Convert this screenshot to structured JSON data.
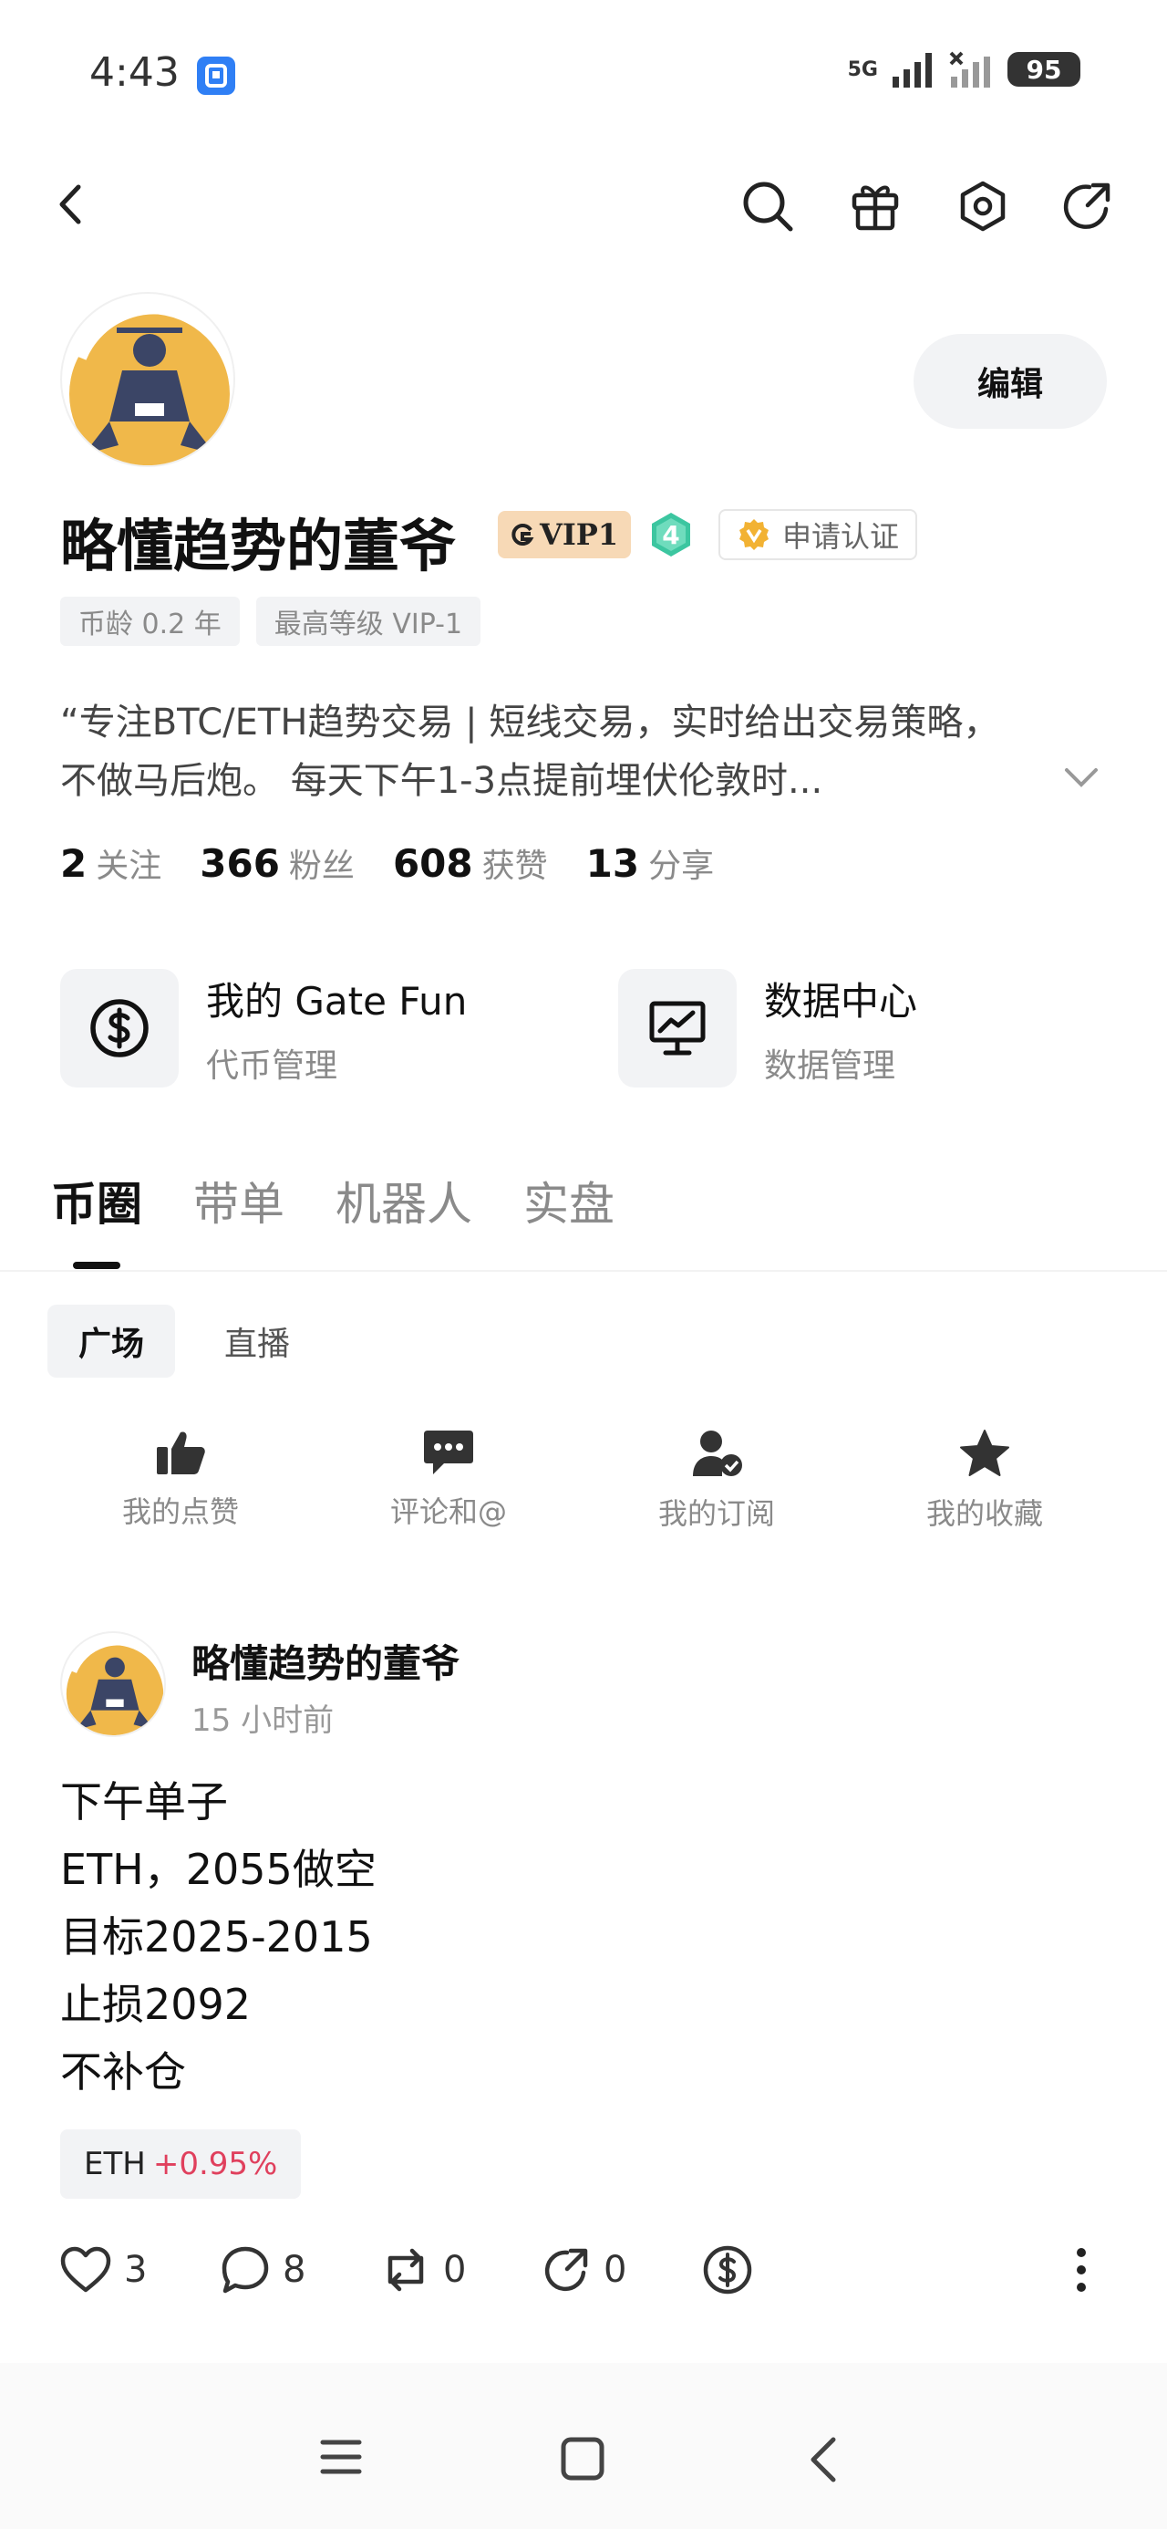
{
  "status_bar": {
    "time": "4:43",
    "network": "5G",
    "battery": "95"
  },
  "top_nav": {
    "icons": [
      "back-icon",
      "search-icon",
      "gift-icon",
      "settings-icon",
      "share-icon"
    ]
  },
  "profile": {
    "name": "略懂趋势的董爷",
    "vip_label": "VIP1",
    "level": "4",
    "verify_label": "申请认证",
    "edit_label": "编辑",
    "tags": [
      "币龄 0.2 年",
      "最高等级 VIP-1"
    ],
    "bio_line1": "“专注BTC/ETH趋势交易 | 短线交易，实时给出交易策略，",
    "bio_line2": "不做马后炮。 每天下午1-3点提前埋伏伦敦时...",
    "stats": [
      {
        "num": "2",
        "label": "关注"
      },
      {
        "num": "366",
        "label": "粉丝"
      },
      {
        "num": "608",
        "label": "获赞"
      },
      {
        "num": "13",
        "label": "分享"
      }
    ]
  },
  "features": [
    {
      "title": "我的 Gate Fun",
      "subtitle": "代币管理",
      "icon": "dollar-circle-icon"
    },
    {
      "title": "数据中心",
      "subtitle": "数据管理",
      "icon": "chart-monitor-icon"
    }
  ],
  "tabs": [
    "币圈",
    "带单",
    "机器人",
    "实盘"
  ],
  "subtabs": [
    "广场",
    "直播"
  ],
  "quick_actions": [
    {
      "label": "我的点赞",
      "icon": "thumbs-up-icon"
    },
    {
      "label": "评论和@",
      "icon": "comment-icon"
    },
    {
      "label": "我的订阅",
      "icon": "subscribe-icon"
    },
    {
      "label": "我的收藏",
      "icon": "star-icon"
    }
  ],
  "post": {
    "author": "略懂趋势的董爷",
    "time": "15 小时前",
    "lines": [
      "下午单子",
      "ETH，2055做空",
      "目标2025-2015",
      "止损2092",
      "不补仓"
    ],
    "token": {
      "name": "ETH",
      "change": "+0.95%"
    },
    "actions": {
      "likes": "3",
      "comments": "8",
      "reposts": "0",
      "shares": "0"
    }
  },
  "colors": {
    "accent_red": "#e0405d",
    "vip_bg": "#f7d9b6",
    "level_green": "#3cc6a0",
    "verify_gold": "#f2b233"
  }
}
